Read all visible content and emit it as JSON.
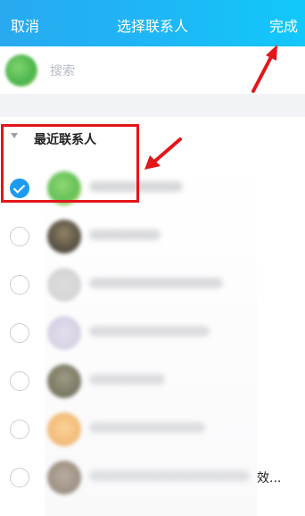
{
  "header": {
    "cancel_label": "取消",
    "title": "选择联系人",
    "done_label": "完成"
  },
  "search": {
    "placeholder": "搜索"
  },
  "section": {
    "label": "最近联系人"
  },
  "contacts": [
    {
      "checked": true,
      "suffix": ""
    },
    {
      "checked": false,
      "suffix": ""
    },
    {
      "checked": false,
      "suffix": ""
    },
    {
      "checked": false,
      "suffix": ""
    },
    {
      "checked": false,
      "suffix": ""
    },
    {
      "checked": false,
      "suffix": ""
    },
    {
      "checked": false,
      "suffix": "效..."
    }
  ],
  "colors": {
    "header_gradient_start": "#28a9f0",
    "header_gradient_end": "#11c8fb",
    "checked_radio": "#1d9bf0",
    "annotation_red": "#e3161a"
  }
}
